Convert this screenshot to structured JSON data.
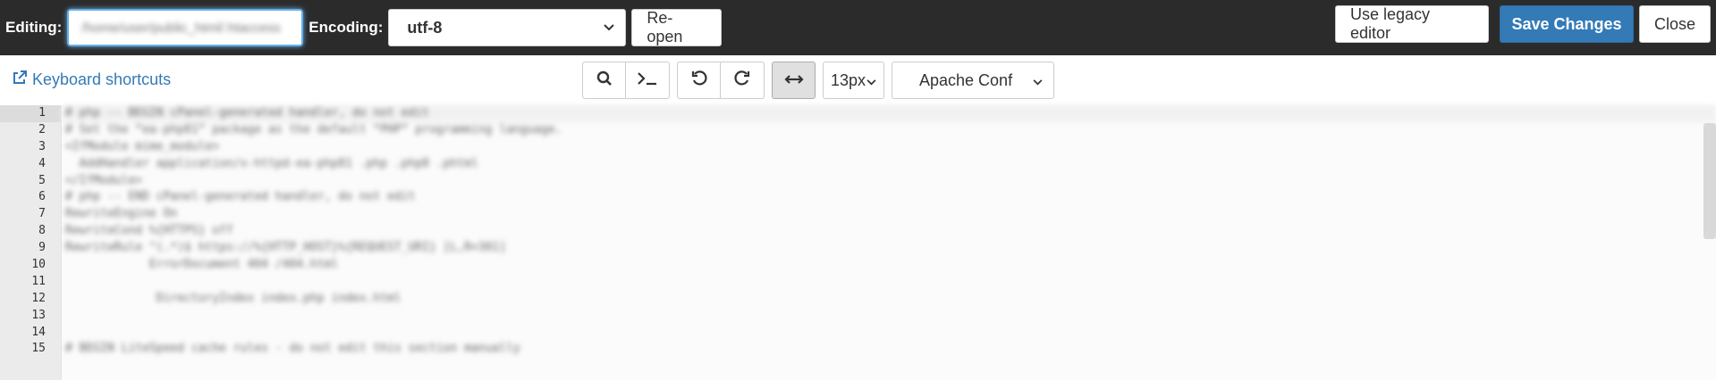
{
  "header": {
    "editing_label": "Editing:",
    "path_value": "/home/user/public_html/.htaccess",
    "encoding_label": "Encoding:",
    "encoding_value": "utf-8",
    "reopen_label": "Re-open",
    "legacy_label": "Use legacy editor",
    "save_label": "Save Changes",
    "close_label": "Close"
  },
  "toolbar": {
    "shortcuts_label": "Keyboard shortcuts",
    "font_size": "13px",
    "mode": "Apache Conf"
  },
  "editor": {
    "line_numbers": [
      "1",
      "2",
      "3",
      "4",
      "5",
      "6",
      "7",
      "8",
      "9",
      "10",
      "11",
      "12",
      "13",
      "14",
      "15"
    ],
    "lines": [
      "# php -- BEGIN cPanel-generated handler, do not edit",
      "# Set the “ea-php81” package as the default “PHP” programming language.",
      "<IfModule mime_module>",
      "  AddHandler application/x-httpd-ea-php81 .php .php8 .phtml",
      "</IfModule>",
      "# php -- END cPanel-generated handler, do not edit",
      "RewriteEngine On",
      "RewriteCond %{HTTPS} off",
      "RewriteRule ^(.*)$ https://%{HTTP_HOST}%{REQUEST_URI} [L,R=301]",
      "            ErrorDocument 404 /404.html",
      "",
      "             DirectoryIndex index.php index.html",
      "",
      "",
      "# BEGIN LiteSpeed cache rules - do not edit this section manually"
    ]
  },
  "colors": {
    "topbar_bg": "#2b2b2b",
    "primary": "#337ab7",
    "gutter_bg": "#ebebeb"
  }
}
